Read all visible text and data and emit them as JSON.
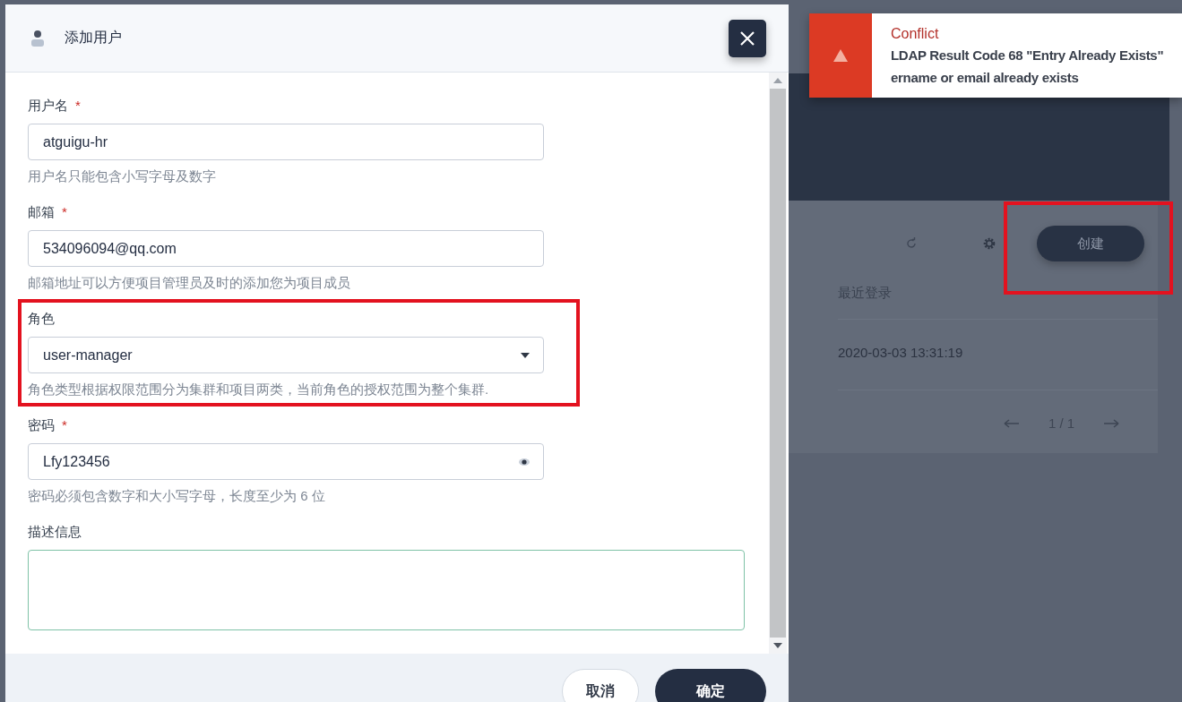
{
  "dialog": {
    "title": "添加用户",
    "fields": [
      {
        "kind": "text",
        "label": "用户名",
        "required_mark": "*",
        "value": "atguigu-hr",
        "hint": "用户名只能包含小写字母及数字"
      },
      {
        "kind": "text",
        "label": "邮箱",
        "required_mark": "*",
        "value": "534096094@qq.com",
        "hint": "邮箱地址可以方便项目管理员及时的添加您为项目成员"
      },
      {
        "kind": "select",
        "label": "角色",
        "value": "user-manager",
        "hint": "角色类型根据权限范围分为集群和项目两类，当前角色的授权范围为整个集群."
      },
      {
        "kind": "password",
        "label": "密码",
        "required_mark": "*",
        "value": "Lfy123456",
        "hint": "密码必须包含数字和大小写字母，长度至少为 6 位"
      },
      {
        "kind": "textarea",
        "label": "描述信息"
      }
    ],
    "buttons": [
      {
        "label": "取消",
        "kind": "secondary"
      },
      {
        "label": "确定",
        "kind": "primary"
      }
    ]
  },
  "background": {
    "create_button": "创建",
    "table": {
      "columns": [
        "最近登录"
      ],
      "rows": [
        [
          "2020-03-03 13:31:19"
        ]
      ]
    },
    "pagination": "1 / 1"
  },
  "notification": {
    "title": "Conflict",
    "lines": [
      "LDAP Result Code 68 \"Entry Already Exists\"",
      "ername or email already exists"
    ]
  }
}
